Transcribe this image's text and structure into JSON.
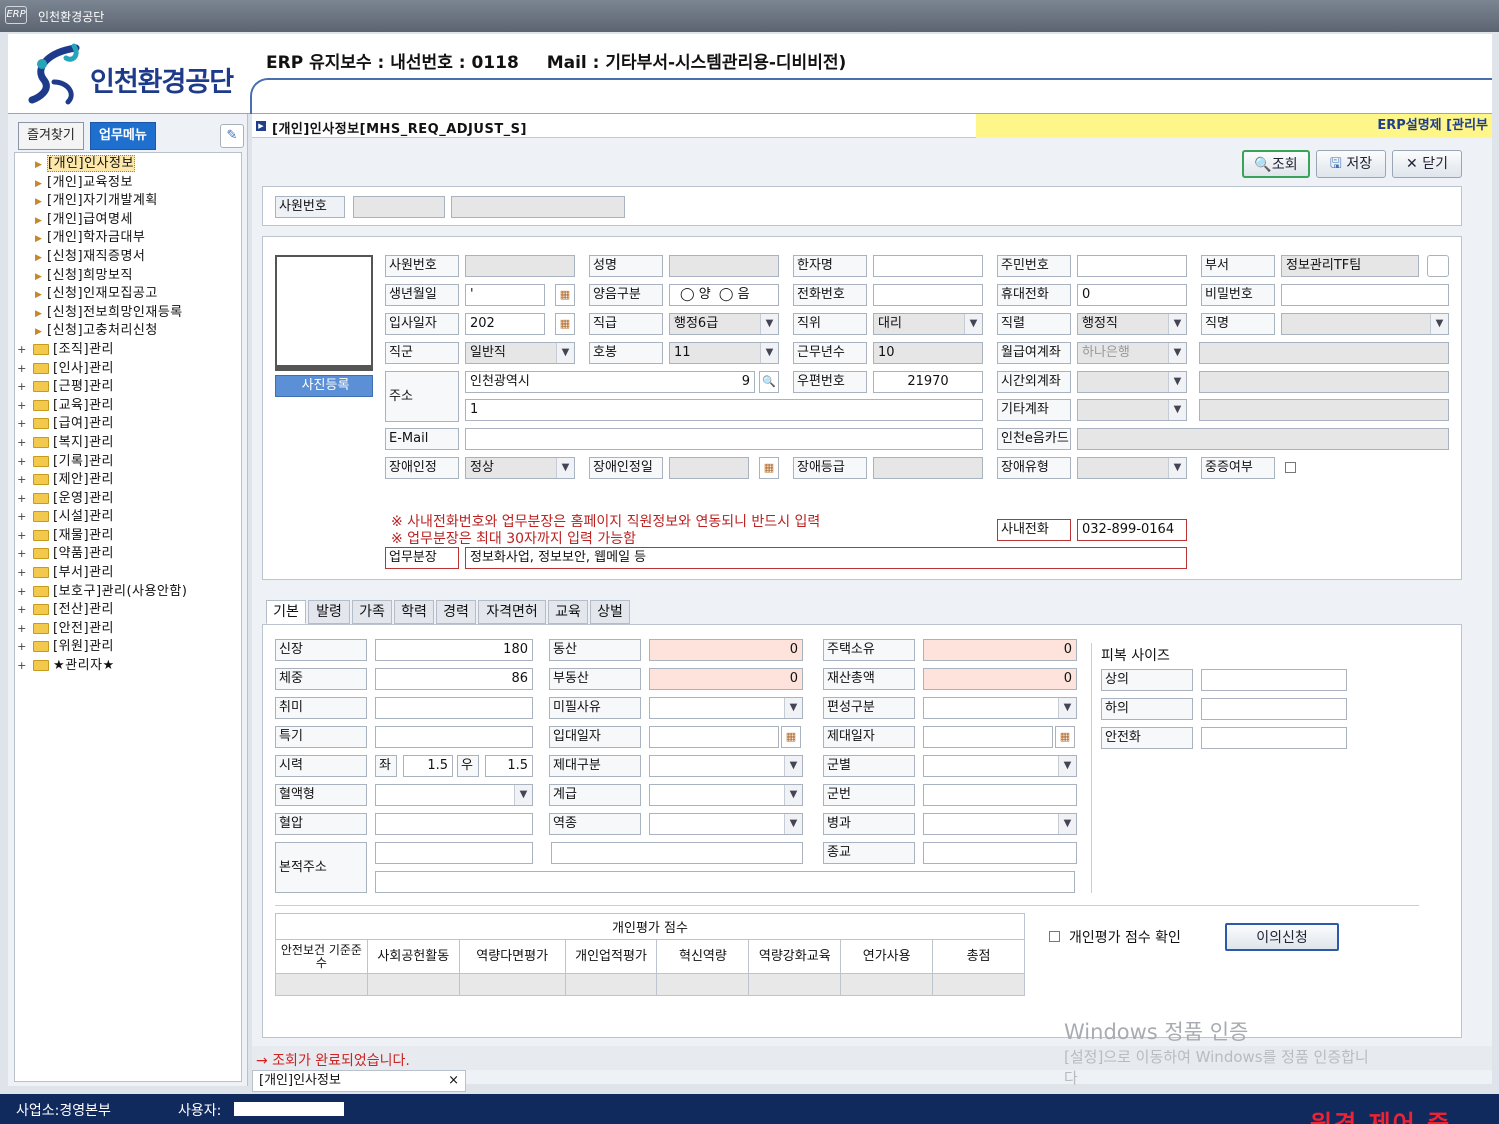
{
  "window": {
    "title": "인천환경공단",
    "icon": "ERP"
  },
  "header": {
    "logo_text": "인천환경공단",
    "maintenance": "ERP 유지보수 : 내선번호 : 0118",
    "mail": "Mail : 기타부서-시스템관리용-디비비전)"
  },
  "sidebar": {
    "tab_fav": "즐겨찾기",
    "tab_menu": "업무메뉴",
    "items": [
      "[개인]인사정보",
      "[개인]교육정보",
      "[개인]자기개발계획",
      "[개인]급여명세",
      "[개인]학자금대부",
      "[신청]재직증명서",
      "[신청]희망보직",
      "[신청]인재모집공고",
      "[신청]전보희망인재등록",
      "[신청]고충처리신청"
    ],
    "folders": [
      "[조직]관리",
      "[인사]관리",
      "[근평]관리",
      "[교육]관리",
      "[급여]관리",
      "[복지]관리",
      "[기록]관리",
      "[제안]관리",
      "[운영]관리",
      "[시설]관리",
      "[재물]관리",
      "[약품]관리",
      "[부서]관리",
      "[보호구]관리(사용안함)",
      "[전산]관리",
      "[안전]관리",
      "[위원]관리",
      "★관리자★"
    ]
  },
  "crumb": {
    "title": "[개인]인사정보[MHS_REQ_ADJUST_S]",
    "erp_note": "ERP설명제 [관리부"
  },
  "toolbar": {
    "search": "조회",
    "save": "저장",
    "close": "닫기"
  },
  "search": {
    "label": "사원번호"
  },
  "profile": {
    "photo_button": "사진등록",
    "labels": {
      "emp_no": "사원번호",
      "name": "성명",
      "hanja": "한자명",
      "rrn": "주민번호",
      "dept": "부서",
      "birth": "생년월일",
      "calendar": "양음구분",
      "phone": "전화번호",
      "mobile": "휴대전화",
      "password": "비밀번호",
      "join": "입사일자",
      "grade": "직급",
      "position": "직위",
      "rank": "직렬",
      "title": "직명",
      "job": "직군",
      "step": "호봉",
      "years": "근무년수",
      "salary_acct": "월급여계좌",
      "address": "주소",
      "zip": "우편번호",
      "ot_acct": "시간외계좌",
      "other_acct": "기타계좌",
      "email": "E-Mail",
      "ecard": "인천e음카드",
      "disability": "장애인정",
      "dis_date": "장애인정일",
      "dis_grade": "장애등급",
      "dis_type": "장애유형",
      "severe": "중증여부",
      "inner_phone": "사내전화",
      "duty": "업무분장"
    },
    "values": {
      "dept": "정보관리TF팀",
      "birth": "'",
      "mobile": "0",
      "join": "202",
      "calendar_opt1": "양",
      "calendar_opt2": "음",
      "grade": "행정6급",
      "position": "대리",
      "rank": "행정직",
      "job": "일반직",
      "step": "11",
      "years": "10",
      "salary_bank": "하나은행",
      "address1": "인천광역시",
      "address_suffix": "9",
      "address2": "1",
      "zip": "21970",
      "disability": "정상",
      "inner_phone": "032-899-0164",
      "duty": "정보화사업, 정보보안, 웹메일 등"
    },
    "notes": [
      "※ 사내전화번호와 업무분장은 홈페이지 직원정보와 연동되니 반드시 입력",
      "※ 업무분장은 최대 30자까지 입력 가능함"
    ]
  },
  "tabs": [
    "기본",
    "발령",
    "가족",
    "학력",
    "경력",
    "자격면허",
    "교육",
    "상벌"
  ],
  "basic": {
    "labels": {
      "height": "신장",
      "weight": "체중",
      "hobby": "취미",
      "special": "특기",
      "vision": "시력",
      "left": "좌",
      "right": "우",
      "blood": "혈액형",
      "bp": "혈압",
      "origin": "본적주소",
      "movable": "동산",
      "realty": "부동산",
      "exempt": "미필사유",
      "enlist": "입대일자",
      "discharge_type": "제대구분",
      "mil_rank": "계급",
      "branch": "역종",
      "house": "주택소유",
      "asset": "재산총액",
      "unit": "편성구분",
      "discharge": "제대일자",
      "army": "군별",
      "mil_no": "군번",
      "arm": "병과",
      "religion": "종교",
      "clothes": "피복 사이즈",
      "top": "상의",
      "bottom": "하의",
      "shoes": "안전화"
    },
    "values": {
      "height": "180",
      "weight": "86",
      "vision_l": "1.5",
      "vision_r": "1.5",
      "movable": "0",
      "realty": "0",
      "house": "0",
      "asset": "0"
    }
  },
  "eval": {
    "title": "개인평가 점수",
    "headers": [
      "안전보건 기준준수",
      "사회공헌활동",
      "역량다면평가",
      "개인업적평가",
      "혁신역량",
      "역량강화교육",
      "연가사용",
      "총점"
    ],
    "confirm": "개인평가 점수 확인",
    "appeal": "이의신청"
  },
  "status": {
    "message": "→ 조회가 완료되었습니다.",
    "tab": "[개인]인사정보",
    "tab_close": "×"
  },
  "footer": {
    "site": "사업소:경영본부",
    "user": "사용자:"
  },
  "watermark": {
    "line1": "Windows 정품 인증",
    "line2": "[설정]으로 이동하여 Windows를 정품 인증합니",
    "line3": "다"
  },
  "remote": "원격 제어 중"
}
